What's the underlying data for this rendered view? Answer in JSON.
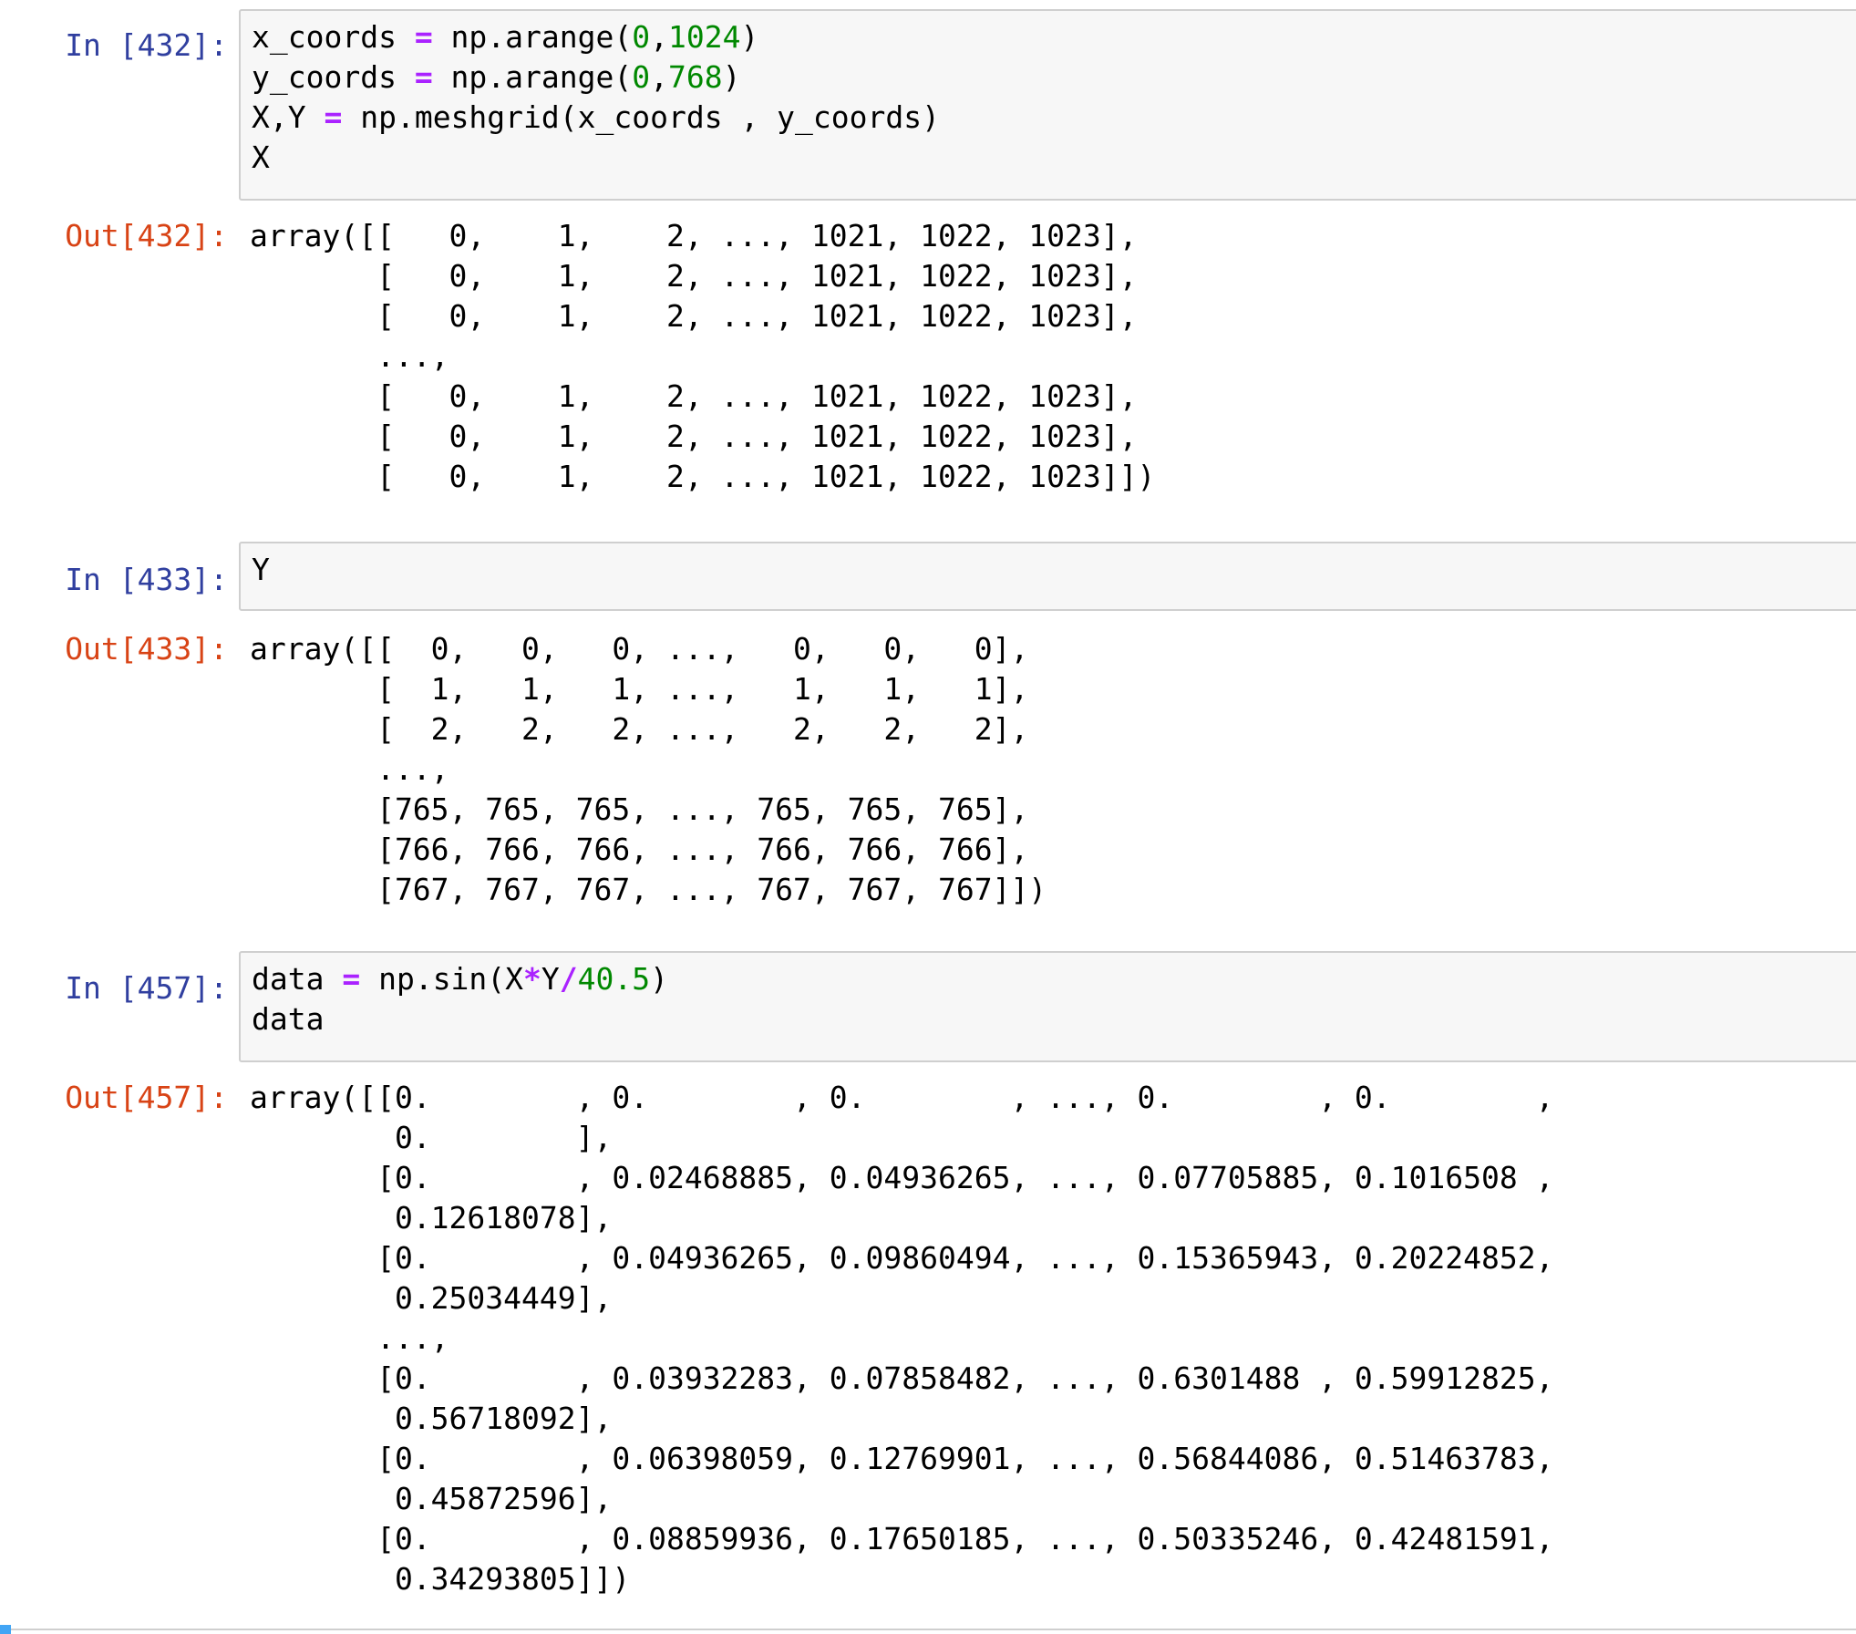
{
  "cells": [
    {
      "in_prompt": "In [432]:",
      "code_lines": [
        [
          {
            "t": "x_coords "
          },
          {
            "t": "=",
            "k": "op"
          },
          {
            "t": " np.arange("
          },
          {
            "t": "0",
            "k": "num"
          },
          {
            "t": ","
          },
          {
            "t": "1024",
            "k": "num"
          },
          {
            "t": ")"
          }
        ],
        [
          {
            "t": "y_coords "
          },
          {
            "t": "=",
            "k": "op"
          },
          {
            "t": " np.arange("
          },
          {
            "t": "0",
            "k": "num"
          },
          {
            "t": ","
          },
          {
            "t": "768",
            "k": "num"
          },
          {
            "t": ")"
          }
        ],
        [
          {
            "t": "X,Y "
          },
          {
            "t": "=",
            "k": "op"
          },
          {
            "t": " np.meshgrid(x_coords , y_coords)"
          }
        ],
        [
          {
            "t": "X"
          }
        ]
      ],
      "out_prompt": "Out[432]:",
      "output_lines": [
        "array([[   0,    1,    2, ..., 1021, 1022, 1023],",
        "       [   0,    1,    2, ..., 1021, 1022, 1023],",
        "       [   0,    1,    2, ..., 1021, 1022, 1023],",
        "       ...,",
        "       [   0,    1,    2, ..., 1021, 1022, 1023],",
        "       [   0,    1,    2, ..., 1021, 1022, 1023],",
        "       [   0,    1,    2, ..., 1021, 1022, 1023]])"
      ]
    },
    {
      "in_prompt": "In [433]:",
      "code_lines": [
        [
          {
            "t": "Y"
          }
        ]
      ],
      "out_prompt": "Out[433]:",
      "output_lines": [
        "array([[  0,   0,   0, ...,   0,   0,   0],",
        "       [  1,   1,   1, ...,   1,   1,   1],",
        "       [  2,   2,   2, ...,   2,   2,   2],",
        "       ...,",
        "       [765, 765, 765, ..., 765, 765, 765],",
        "       [766, 766, 766, ..., 766, 766, 766],",
        "       [767, 767, 767, ..., 767, 767, 767]])"
      ]
    },
    {
      "in_prompt": "In [457]:",
      "code_lines": [
        [
          {
            "t": "data "
          },
          {
            "t": "=",
            "k": "op"
          },
          {
            "t": " np.sin(X"
          },
          {
            "t": "*",
            "k": "op"
          },
          {
            "t": "Y"
          },
          {
            "t": "/",
            "k": "op"
          },
          {
            "t": "40.5",
            "k": "num"
          },
          {
            "t": ")"
          }
        ],
        [
          {
            "t": "data"
          }
        ]
      ],
      "out_prompt": "Out[457]:",
      "output_lines": [
        "array([[0.        , 0.        , 0.        , ..., 0.        , 0.        ,",
        "        0.        ],",
        "       [0.        , 0.02468885, 0.04936265, ..., 0.07705885, 0.1016508 ,",
        "        0.12618078],",
        "       [0.        , 0.04936265, 0.09860494, ..., 0.15365943, 0.20224852,",
        "        0.25034449],",
        "       ...,",
        "       [0.        , 0.03932283, 0.07858482, ..., 0.6301488 , 0.59912825,",
        "        0.56718092],",
        "       [0.        , 0.06398059, 0.12769901, ..., 0.56844086, 0.51463783,",
        "        0.45872596],",
        "       [0.        , 0.08859936, 0.17650185, ..., 0.50335246, 0.42481591,",
        "        0.34293805]])"
      ]
    }
  ],
  "colors": {
    "in_prompt": "#303f9f",
    "out_prompt": "#d84315",
    "operator": "#aa22ff",
    "number": "#008800",
    "input_background": "#f7f7f7",
    "input_border": "#cfcfcf"
  }
}
